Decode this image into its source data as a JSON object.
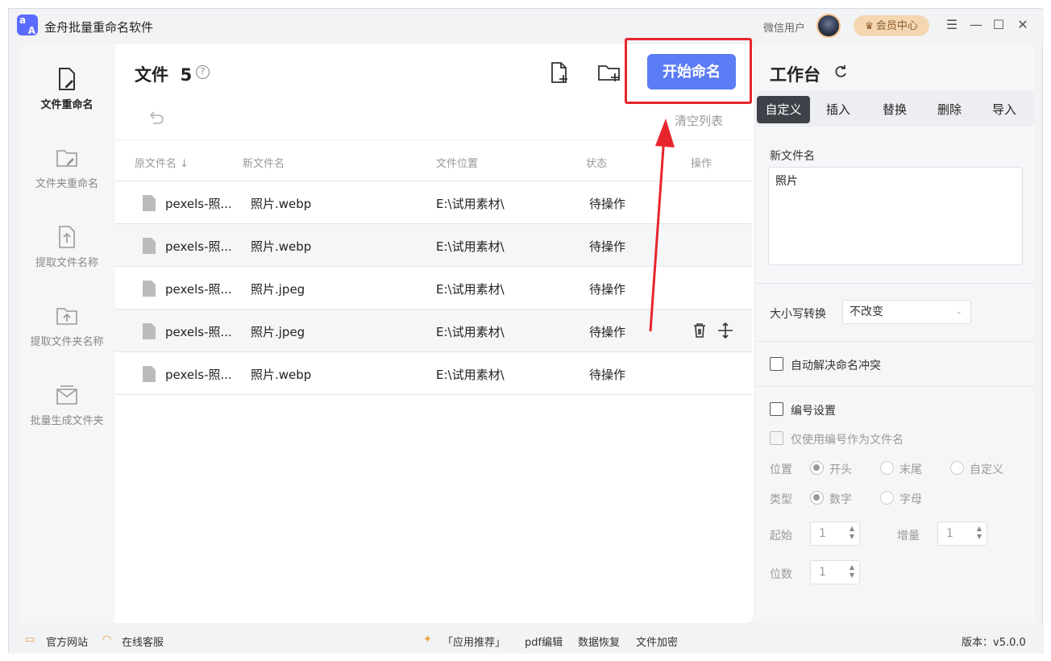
{
  "app": {
    "title": "金舟批量重命名软件",
    "logo_text_top": "a",
    "logo_text_bottom": "A",
    "user_name": "微信用户",
    "vip_label": "会员中心"
  },
  "window_controls": {
    "menu": "☰",
    "minimize": "—",
    "maximize": "☐",
    "close": "✕"
  },
  "sidebar": {
    "items": [
      {
        "label": "文件重命名",
        "icon": "file-edit-icon",
        "active": true
      },
      {
        "label": "文件夹重命名",
        "icon": "folder-edit-icon",
        "active": false
      },
      {
        "label": "提取文件名称",
        "icon": "file-extract-icon",
        "active": false
      },
      {
        "label": "提取文件夹名称",
        "icon": "folder-extract-icon",
        "active": false
      },
      {
        "label": "批量生成文件夹",
        "icon": "folder-batch-icon",
        "active": false
      }
    ]
  },
  "main": {
    "title": "文件",
    "count": "5",
    "help": "?",
    "start_button": "开始命名",
    "clear_list": "清空列表",
    "columns": {
      "original": "原文件名",
      "new": "新文件名",
      "location": "文件位置",
      "status": "状态",
      "actions": "操作"
    },
    "rows": [
      {
        "original": "pexels-照...",
        "new": "照片.webp",
        "location": "E:\\试用素材\\",
        "status": "待操作"
      },
      {
        "original": "pexels-照...",
        "new": "照片.webp",
        "location": "E:\\试用素材\\",
        "status": "待操作"
      },
      {
        "original": "pexels-照...",
        "new": "照片.jpeg",
        "location": "E:\\试用素材\\",
        "status": "待操作"
      },
      {
        "original": "pexels-照...",
        "new": "照片.jpeg",
        "location": "E:\\试用素材\\",
        "status": "待操作"
      },
      {
        "original": "pexels-照...",
        "new": "照片.webp",
        "location": "E:\\试用素材\\",
        "status": "待操作"
      }
    ]
  },
  "workbench": {
    "title": "工作台",
    "tabs": [
      "自定义",
      "插入",
      "替换",
      "删除",
      "导入"
    ],
    "active_tab": "自定义",
    "new_name_label": "新文件名",
    "new_name_value": "照片",
    "case_label": "大小写转换",
    "case_value": "不改变",
    "auto_resolve_label": "自动解决命名冲突",
    "numbering_label": "编号设置",
    "only_number_label": "仅使用编号作为文件名",
    "position_label": "位置",
    "position_options": [
      "开头",
      "末尾",
      "自定义"
    ],
    "type_label": "类型",
    "type_options": [
      "数字",
      "字母"
    ],
    "start_label": "起始",
    "start_value": "1",
    "increment_label": "增量",
    "increment_value": "1",
    "digits_label": "位数",
    "digits_value": "1"
  },
  "footer": {
    "website": "官方网站",
    "support": "在线客服",
    "recommend": "「应用推荐」",
    "links": [
      "pdf编辑",
      "数据恢复",
      "文件加密"
    ],
    "version": "版本：v5.0.0"
  }
}
